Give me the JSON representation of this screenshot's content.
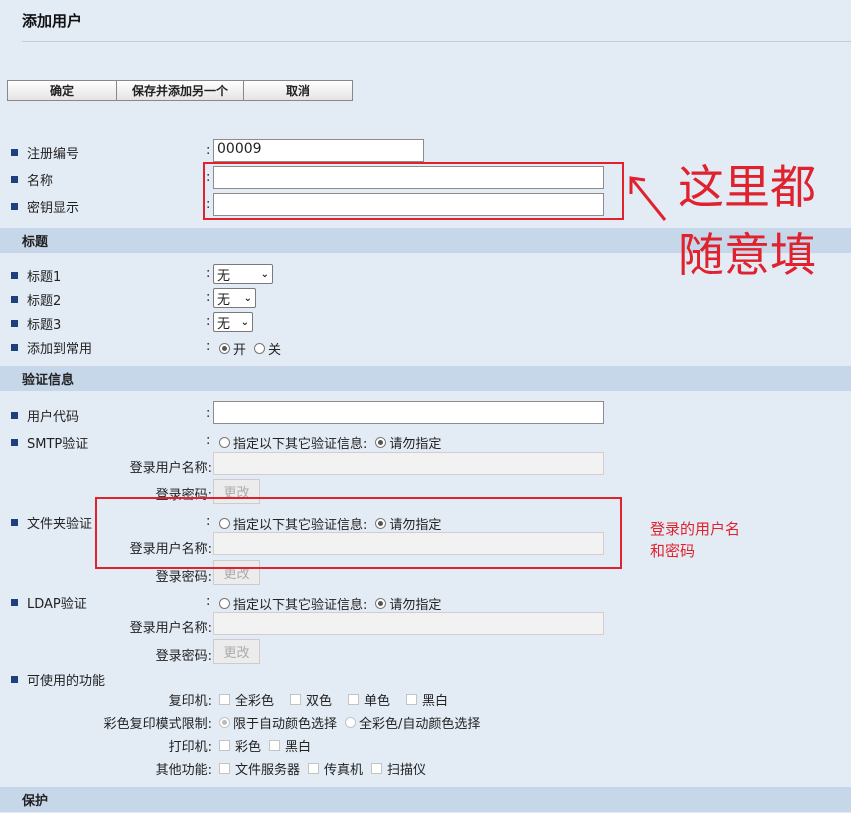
{
  "page": {
    "title": "添加用户"
  },
  "toolbar": {
    "ok": "确定",
    "save_add": "保存并添加另一个",
    "cancel": "取消"
  },
  "basic": {
    "reg_no_label": "注册编号",
    "reg_no_value": "00009",
    "name_label": "名称",
    "name_value": "",
    "key_label": "密钥显示",
    "key_value": ""
  },
  "sections": {
    "title": "标题",
    "auth": "验证信息",
    "protect": "保护"
  },
  "titles": {
    "t1_label": "标题1",
    "t1_value": "无",
    "t2_label": "标题2",
    "t2_value": "无",
    "t3_label": "标题3",
    "t3_value": "无",
    "fav_label": "添加到常用",
    "on": "开",
    "off": "关"
  },
  "auth": {
    "user_code_label": "用户代码",
    "smtp_label": "SMTP验证",
    "folder_label": "文件夹验证",
    "ldap_label": "LDAP验证",
    "opt_specify": "指定以下其它验证信息:",
    "opt_none": "请勿指定",
    "login_name_label": "登录用户名称:",
    "login_pw_label": "登录密码:",
    "change_btn": "更改"
  },
  "functions": {
    "label": "可使用的功能",
    "copier_label": "复印机:",
    "copier_opts": [
      "全彩色",
      "双色",
      "单色",
      "黑白"
    ],
    "color_limit_label": "彩色复印模式限制:",
    "color_limit_opts": [
      "限于自动颜色选择",
      "全彩色/自动颜色选择"
    ],
    "printer_label": "打印机:",
    "printer_opts": [
      "彩色",
      "黑白"
    ],
    "other_label": "其他功能:",
    "other_opts": [
      "文件服务器",
      "传真机",
      "扫描仪"
    ]
  },
  "annotations": {
    "big_line1": "这里都",
    "big_line2": "随意填",
    "small_line1": "登录的用户名",
    "small_line2": "和密码"
  },
  "colors": {
    "annotation_red": "#e0222e",
    "section_bg": "#c7d7ea",
    "page_bg": "#e3ebf5",
    "bullet": "#1f3f7f"
  }
}
